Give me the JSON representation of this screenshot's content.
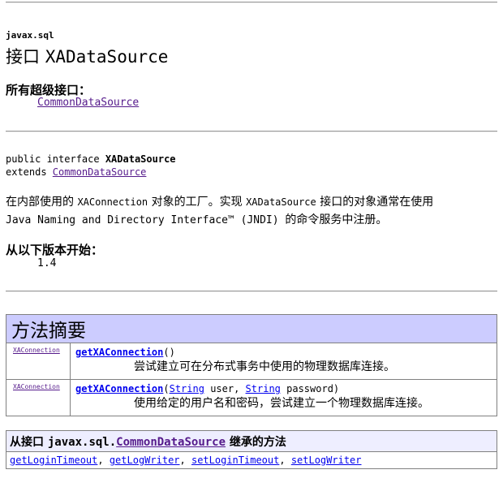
{
  "package": "javax.sql",
  "title": {
    "prefix": "接口",
    "name": "XADataSource"
  },
  "superinterfaces": {
    "label": "所有超级接口：",
    "items": [
      "CommonDataSource"
    ]
  },
  "declaration": {
    "line1_prefix": "public interface ",
    "line1_name": "XADataSource",
    "line2_prefix": "extends ",
    "line2_link": "CommonDataSource"
  },
  "description": {
    "l1_a": "在内部使用的 ",
    "l1_code1": "XAConnection",
    "l1_b": " 对象的工厂。实现 ",
    "l1_code2": "XADataSource",
    "l1_c": " 接口的对象通常在使用",
    "l2_a": "Java Naming and Directory Interface™ (JNDI) ",
    "l2_b": "的命令服务中注册。"
  },
  "since": {
    "label": "从以下版本开始：",
    "value": "1.4"
  },
  "method_summary": {
    "header": "方法摘要",
    "rows": [
      {
        "return_type": "XAConnection",
        "name": "getXAConnection",
        "params_text": "()",
        "description": "尝试建立可在分布式事务中使用的物理数据库连接。"
      },
      {
        "return_type": "XAConnection",
        "name": "getXAConnection",
        "param1_type": "String",
        "param1_name": " user, ",
        "param2_type": "String",
        "param2_name": " password)",
        "description": "使用给定的用户名和密码，尝试建立一个物理数据库连接。"
      }
    ]
  },
  "inherited": {
    "prefix": "从接口 ",
    "pkg": "javax.sql.",
    "iface": "CommonDataSource",
    "suffix": " 继承的方法",
    "methods": [
      "getLoginTimeout",
      "getLogWriter",
      "setLoginTimeout",
      "setLogWriter"
    ],
    "separator": ", "
  }
}
